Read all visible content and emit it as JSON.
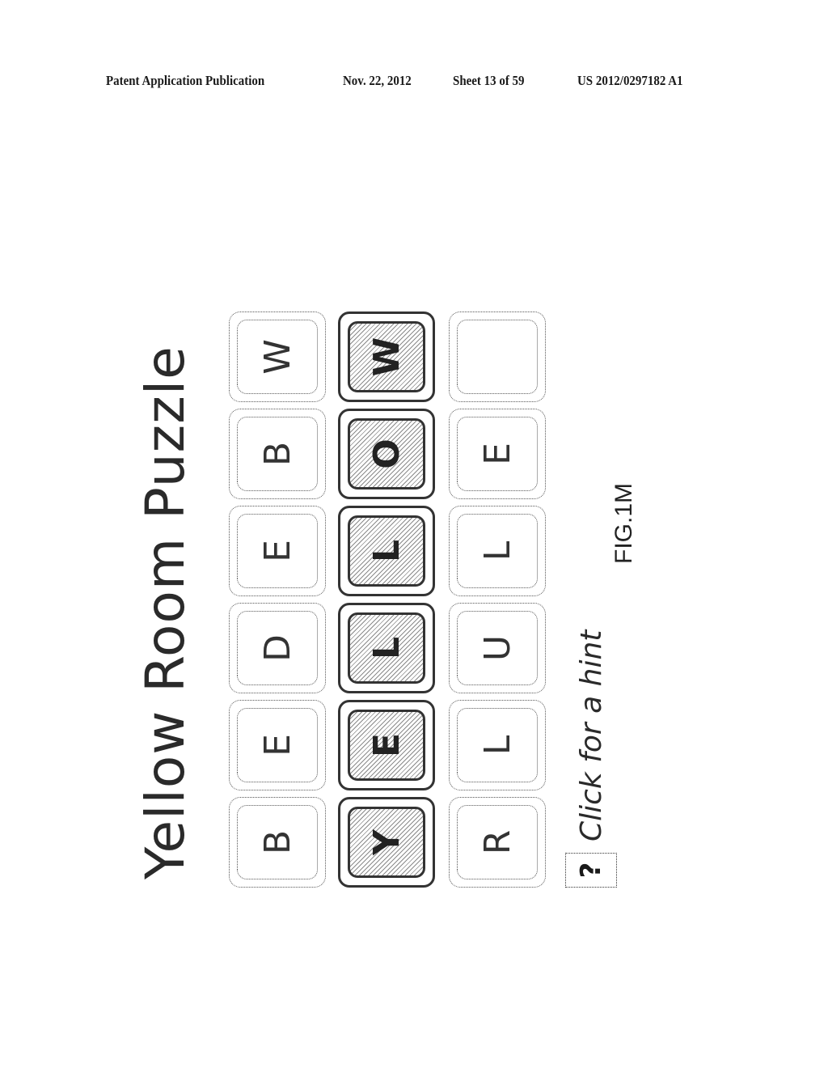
{
  "header": {
    "publication": "Patent Application Publication",
    "date": "Nov. 22, 2012",
    "sheet": "Sheet 13 of 59",
    "pub_number": "US 2012/0297182 A1"
  },
  "figure": {
    "title": "Yellow Room Puzzle",
    "orientation": "rotated 90° counter-clockwise",
    "rows": [
      {
        "tiles": [
          {
            "letter": "B",
            "selected": false
          },
          {
            "letter": "E",
            "selected": false
          },
          {
            "letter": "D",
            "selected": false
          },
          {
            "letter": "E",
            "selected": false
          },
          {
            "letter": "B",
            "selected": false
          },
          {
            "letter": "W",
            "selected": false
          }
        ]
      },
      {
        "tiles": [
          {
            "letter": "Y",
            "selected": true
          },
          {
            "letter": "E",
            "selected": true
          },
          {
            "letter": "L",
            "selected": true
          },
          {
            "letter": "L",
            "selected": true
          },
          {
            "letter": "O",
            "selected": true
          },
          {
            "letter": "W",
            "selected": true
          }
        ]
      },
      {
        "tiles": [
          {
            "letter": "R",
            "selected": false
          },
          {
            "letter": "L",
            "selected": false
          },
          {
            "letter": "U",
            "selected": false
          },
          {
            "letter": "L",
            "selected": false
          },
          {
            "letter": "E",
            "selected": false
          },
          {
            "letter": "",
            "selected": false
          }
        ]
      }
    ],
    "hint": {
      "icon": "question-mark-icon",
      "symbol": "?",
      "label": "Click for a hint"
    },
    "caption": "FIG.1M"
  }
}
